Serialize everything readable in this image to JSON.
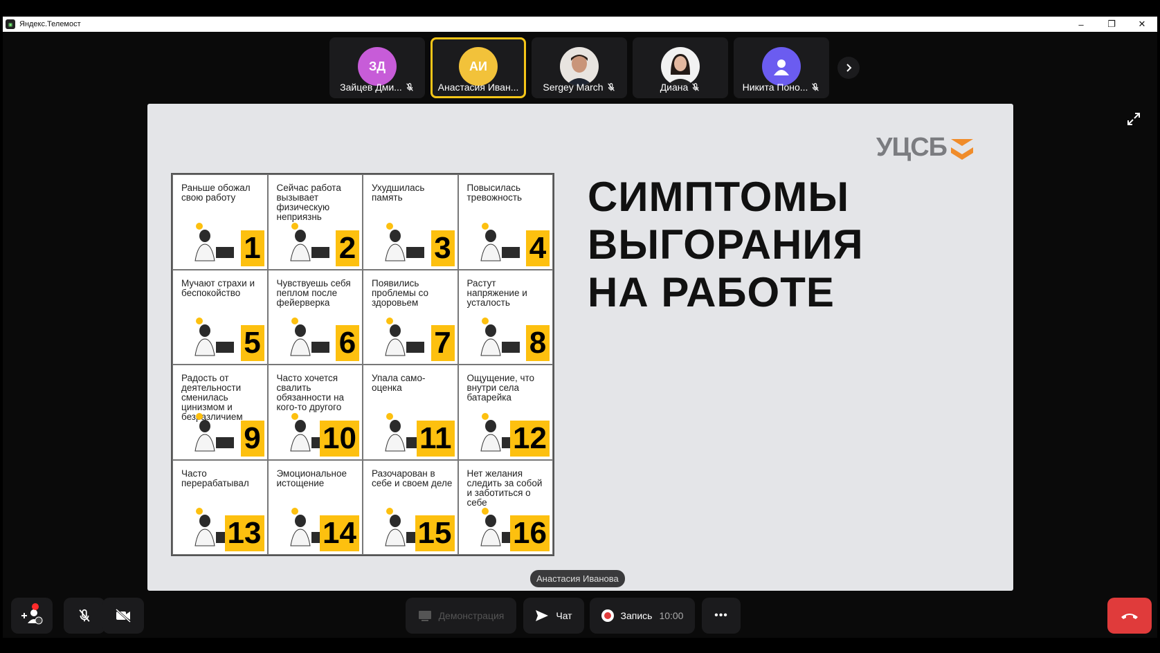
{
  "window": {
    "title": "Яндекс.Телемост",
    "minimize": "–",
    "maximize": "❐",
    "close": "✕"
  },
  "participants": [
    {
      "initials": "ЗД",
      "name": "Зайцев Дми...",
      "color": "#c75cd8",
      "muted": true,
      "active": false
    },
    {
      "initials": "АИ",
      "name": "Анастасия Иван...",
      "color": "#f2c23a",
      "muted": false,
      "active": true
    },
    {
      "initials": "",
      "name": "Sergey March",
      "color": "#8a6e5c",
      "muted": true,
      "active": false
    },
    {
      "initials": "",
      "name": "Диана",
      "color": "#ddd",
      "muted": true,
      "active": false
    },
    {
      "initials": "",
      "name": "Никита Поно...",
      "color": "#6b5cf0",
      "muted": true,
      "active": false
    }
  ],
  "slide": {
    "logo": "УЦСБ",
    "title_lines": [
      "СИМПТОМЫ",
      "ВЫГОРАНИЯ",
      "НА РАБОТЕ"
    ],
    "cells": [
      {
        "text": "Раньше обожал свою работу",
        "num": "1"
      },
      {
        "text": "Сейчас работа вызывает физическую неприязнь",
        "num": "2"
      },
      {
        "text": "Ухудшилась память",
        "num": "3"
      },
      {
        "text": "Повысилась тревожность",
        "num": "4"
      },
      {
        "text": "Мучают страхи и беспокойство",
        "num": "5"
      },
      {
        "text": "Чувствуешь себя пеплом после фейерверка",
        "num": "6"
      },
      {
        "text": "Появились проблемы со здоровьем",
        "num": "7"
      },
      {
        "text": "Растут напряжение и усталость",
        "num": "8"
      },
      {
        "text": "Радость от деятельности сменилась цинизмом и безразличием",
        "num": "9"
      },
      {
        "text": "Часто хочется свалить обязанности на кого-то другого",
        "num": "10"
      },
      {
        "text": "Упала само-оценка",
        "num": "11"
      },
      {
        "text": "Ощущение, что внутри села батарейка",
        "num": "12"
      },
      {
        "text": "Часто перерабатывал",
        "num": "13"
      },
      {
        "text": "Эмоциональное истощение",
        "num": "14"
      },
      {
        "text": "Разочарован в себе и своем деле",
        "num": "15"
      },
      {
        "text": "Нет желания следить за собой и заботиться о себе",
        "num": "16"
      }
    ]
  },
  "speaker_label": "Анастасия Иванова",
  "controls": {
    "demo_label": "Демонстрация",
    "chat_label": "Чат",
    "record_label": "Запись",
    "record_time": "10:00",
    "more_label": "•••"
  },
  "colors": {
    "accent": "#f5c518",
    "number_bg": "#fdc00f",
    "end_call": "#e03b3b"
  }
}
